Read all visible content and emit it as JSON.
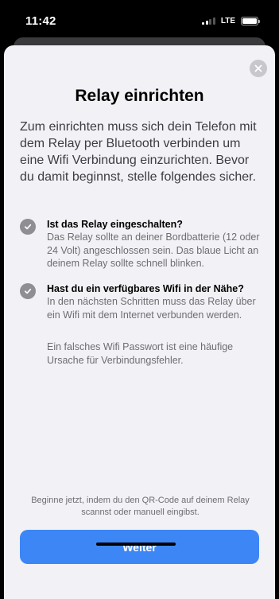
{
  "status_bar": {
    "time": "11:42",
    "network": "LTE",
    "signal_bars_active": 2,
    "signal_bars_total": 4,
    "battery_level": 1.0
  },
  "sheet": {
    "title": "Relay einrichten",
    "intro": "Zum einrichten muss sich dein Telefon mit dem Relay per Bluetooth verbinden um eine Wifi Verbindung einzurichten. Bevor du damit beginnst, stelle folgendes sicher.",
    "checklist": [
      {
        "title": "Ist das Relay eingeschalten?",
        "description": "Das Relay sollte an deiner Bordbatterie (12 oder 24 Volt) angeschlossen sein. Das blaue Licht an deinem Relay sollte schnell blinken."
      },
      {
        "title": "Hast du ein verfügbares Wifi in der Nähe?",
        "description": "In den nächsten Schritten muss das Relay über ein Wifi mit dem Internet verbunden werden."
      }
    ],
    "note": "Ein falsches Wifi Passwort ist eine häufige Ursache für Verbindungsfehler.",
    "footer_hint": "Beginne jetzt, indem du den QR-Code auf deinem Relay scannst oder manuell eingibst.",
    "next_label": "Weiter"
  },
  "colors": {
    "accent": "#3d86f5",
    "sheet_background": "#f2f2f6",
    "check_icon": "#8e8e93"
  },
  "icons": {
    "close": "close-icon",
    "check": "checkmark-icon"
  }
}
